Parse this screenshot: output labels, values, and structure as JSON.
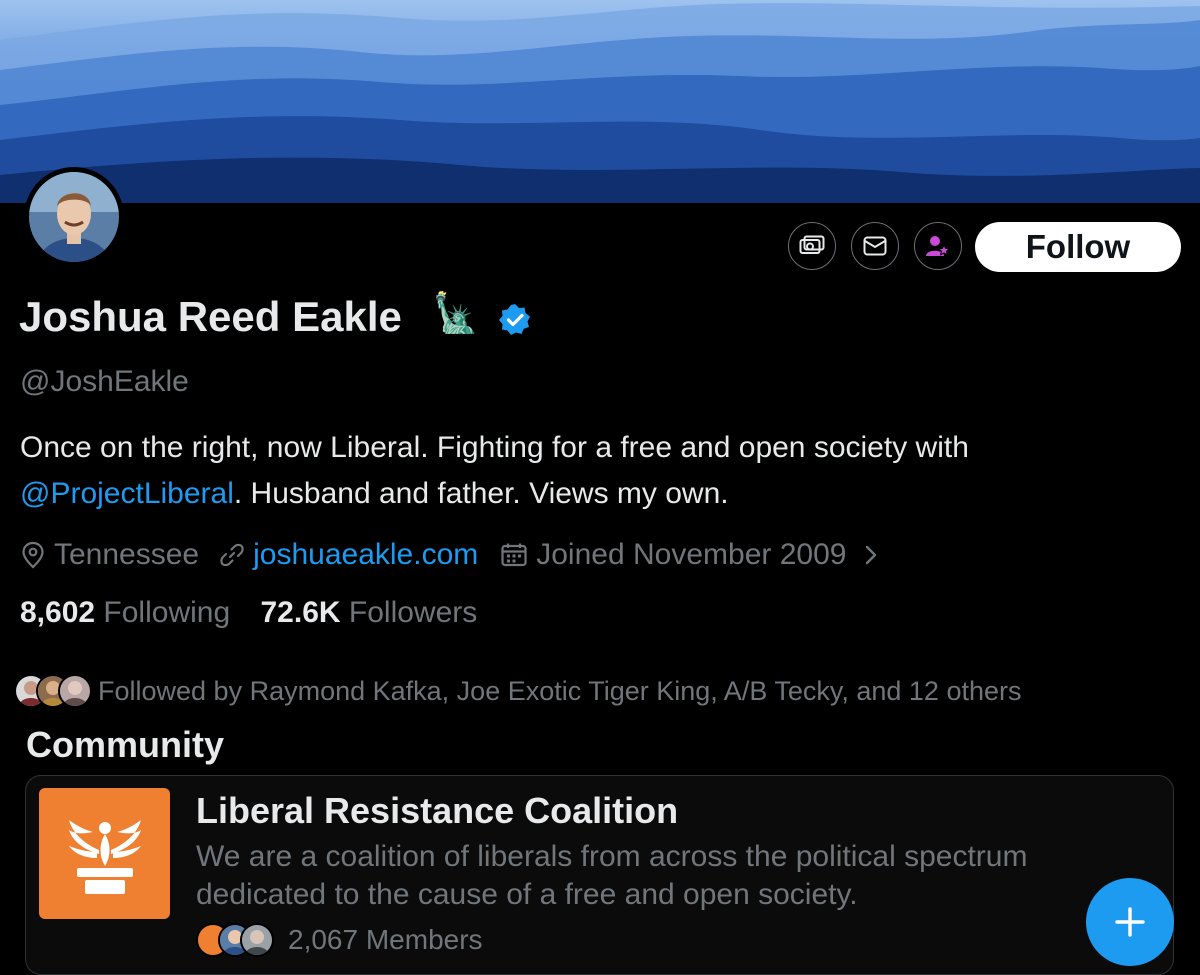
{
  "profile": {
    "name": "Joshua Reed Eakle",
    "name_emoji": "🗽",
    "handle": "@JoshEakle",
    "bio_before": "Once on the right, now Liberal. Fighting for a free and open society with ",
    "bio_mention": "@ProjectLiberal",
    "bio_after": ". Husband and father. Views my own.",
    "location": "Tennessee",
    "website": "joshuaeakle.com",
    "joined": "Joined November 2009",
    "following_count": "8,602",
    "following_label": "Following",
    "followers_count": "72.6K",
    "followers_label": "Followers"
  },
  "actions": {
    "follow_label": "Follow",
    "icons": [
      "subscribe-money-icon",
      "message-icon",
      "subscription-star-icon"
    ]
  },
  "followed_by": {
    "text": "Followed by Raymond Kafka, Joe Exotic Tiger King, A/B Tecky, and 12 others"
  },
  "community": {
    "section_title": "Community",
    "name": "Liberal Resistance Coalition",
    "description": "We are a coalition of liberals from across the political spectrum dedicated to the cause of a free and open society.",
    "members": "2,067 Members"
  },
  "colors": {
    "accent": "#1d9bf0",
    "community_logo_bg": "#ef7f31",
    "verified": "#1d9bf0",
    "subscribe_accent": "#c94bd6"
  }
}
